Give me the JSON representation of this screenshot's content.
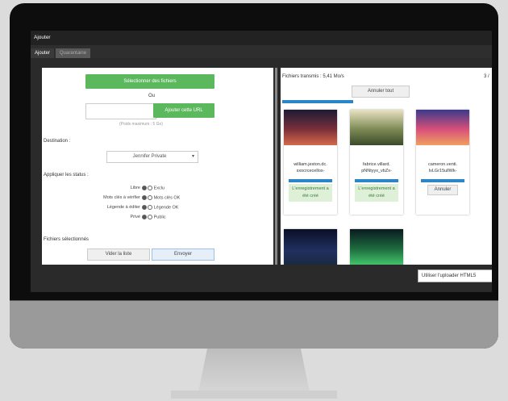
{
  "window": {
    "title": "Ajouter"
  },
  "tabs": [
    {
      "label": "Ajouter"
    },
    {
      "label": "Quarantaine"
    }
  ],
  "left": {
    "select_files_button": "Sélectionner des fichiers",
    "or_text": "Ou",
    "url_placeholder": "",
    "add_url_button": "Ajouter cette URL",
    "max_weight": "(Poids maximum : 5 Go)",
    "destination_label": "Destination :",
    "destination_value": "Jennifer Private",
    "apply_status_label": "Appliquer les status :",
    "status_rows": [
      {
        "left": "Libre",
        "right": "Exclu"
      },
      {
        "left": "Mots clés à vérifier",
        "right": "Mots clés OK"
      },
      {
        "left": "Légende à éditer",
        "right": "Légende OK"
      },
      {
        "left": "Privé",
        "right": "Public"
      }
    ],
    "selected_files_label": "Fichiers sélectionnés",
    "empty_list_button": "Vider la liste",
    "send_button": "Envoyer"
  },
  "right": {
    "transferred": "Fichiers transmis : 5,41 Mo/s",
    "counter": "3 /",
    "cancel_all_button": "Annuler tout",
    "thumbnails": [
      {
        "filename": "william.jeston.dc. sxocrcecellox-",
        "status": "L'enregistrement a été créé",
        "colors": [
          "#1b1b35",
          "#7a2f3a",
          "#d46b4a"
        ]
      },
      {
        "filename": "fabrice.villard. pNNtyyx_vbZx-",
        "status": "L'enregistrement a été créé",
        "colors": [
          "#e9e2c2",
          "#7d8a55",
          "#3b4a2b"
        ]
      },
      {
        "filename": "cameron.venti. IvLGr15ullWk-",
        "status": "Annuler",
        "colors": [
          "#3a3a8a",
          "#d84f7a",
          "#f0a060"
        ]
      },
      {
        "filename": "",
        "status": "",
        "colors": [
          "#0a0f25",
          "#203060",
          "#1a2a40"
        ]
      },
      {
        "filename": "",
        "status": "",
        "colors": [
          "#0a1a20",
          "#1d6b3e",
          "#43c26a"
        ]
      }
    ]
  },
  "tooltip": {
    "text": "Utiliser l'uploader HTML5"
  }
}
